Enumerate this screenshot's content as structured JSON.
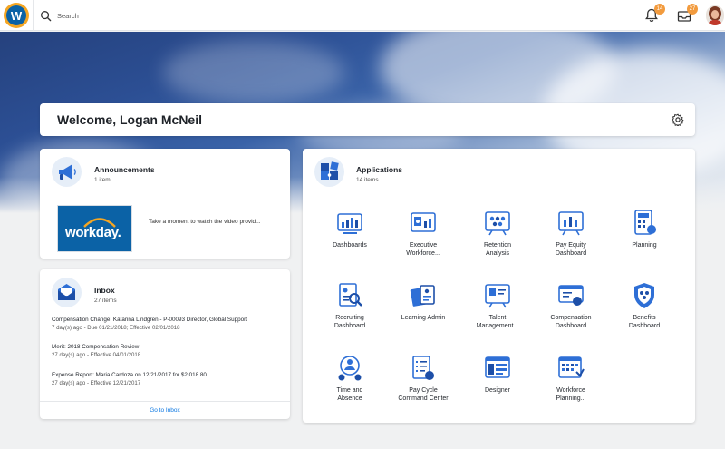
{
  "topbar": {
    "logo_letter": "W",
    "search_placeholder": "Search",
    "notifications_count": "14",
    "inbox_count": "27"
  },
  "welcome": {
    "title": "Welcome, Logan McNeil"
  },
  "announcements": {
    "title": "Announcements",
    "count": "1 item",
    "video_logo_text": "workday.",
    "video_caption": "Take a moment to watch the video provid..."
  },
  "inbox": {
    "title": "Inbox",
    "count": "27 items",
    "items": [
      {
        "title": "Compensation Change: Katarina Lindgren - P-00093 Director, Global Support",
        "meta": "7 day(s) ago - Due 01/21/2018; Effective 02/01/2018"
      },
      {
        "title": "Merit: 2018 Compensation Review",
        "meta": "27 day(s) ago - Effective 04/01/2018"
      },
      {
        "title": "Expense Report: Maria Cardoza on 12/21/2017 for $2,018.80",
        "meta": "27 day(s) ago - Effective 12/21/2017"
      }
    ],
    "footer_link": "Go to Inbox"
  },
  "applications": {
    "title": "Applications",
    "count": "14 items",
    "apps": [
      {
        "line1": "Dashboards",
        "line2": "",
        "icon": "dashboards-icon"
      },
      {
        "line1": "Executive",
        "line2": "Workforce...",
        "icon": "executive-workforce-icon"
      },
      {
        "line1": "Retention",
        "line2": "Analysis",
        "icon": "retention-analysis-icon"
      },
      {
        "line1": "Pay Equity",
        "line2": "Dashboard",
        "icon": "pay-equity-icon"
      },
      {
        "line1": "Planning",
        "line2": "",
        "icon": "planning-icon"
      },
      {
        "line1": "Recruiting",
        "line2": "Dashboard",
        "icon": "recruiting-icon"
      },
      {
        "line1": "Learning Admin",
        "line2": "",
        "icon": "learning-admin-icon"
      },
      {
        "line1": "Talent",
        "line2": "Management...",
        "icon": "talent-management-icon"
      },
      {
        "line1": "Compensation",
        "line2": "Dashboard",
        "icon": "compensation-icon"
      },
      {
        "line1": "Benefits",
        "line2": "Dashboard",
        "icon": "benefits-icon"
      },
      {
        "line1": "Time and",
        "line2": "Absence",
        "icon": "time-absence-icon"
      },
      {
        "line1": "Pay Cycle",
        "line2": "Command Center",
        "icon": "pay-cycle-icon"
      },
      {
        "line1": "Designer",
        "line2": "",
        "icon": "designer-icon"
      },
      {
        "line1": "Workforce",
        "line2": "Planning...",
        "icon": "workforce-planning-icon"
      }
    ]
  },
  "colors": {
    "brand_blue": "#0b62a6",
    "brand_orange": "#f5a623",
    "link_blue": "#0875e1",
    "icon_blue": "#2e6fd6"
  }
}
